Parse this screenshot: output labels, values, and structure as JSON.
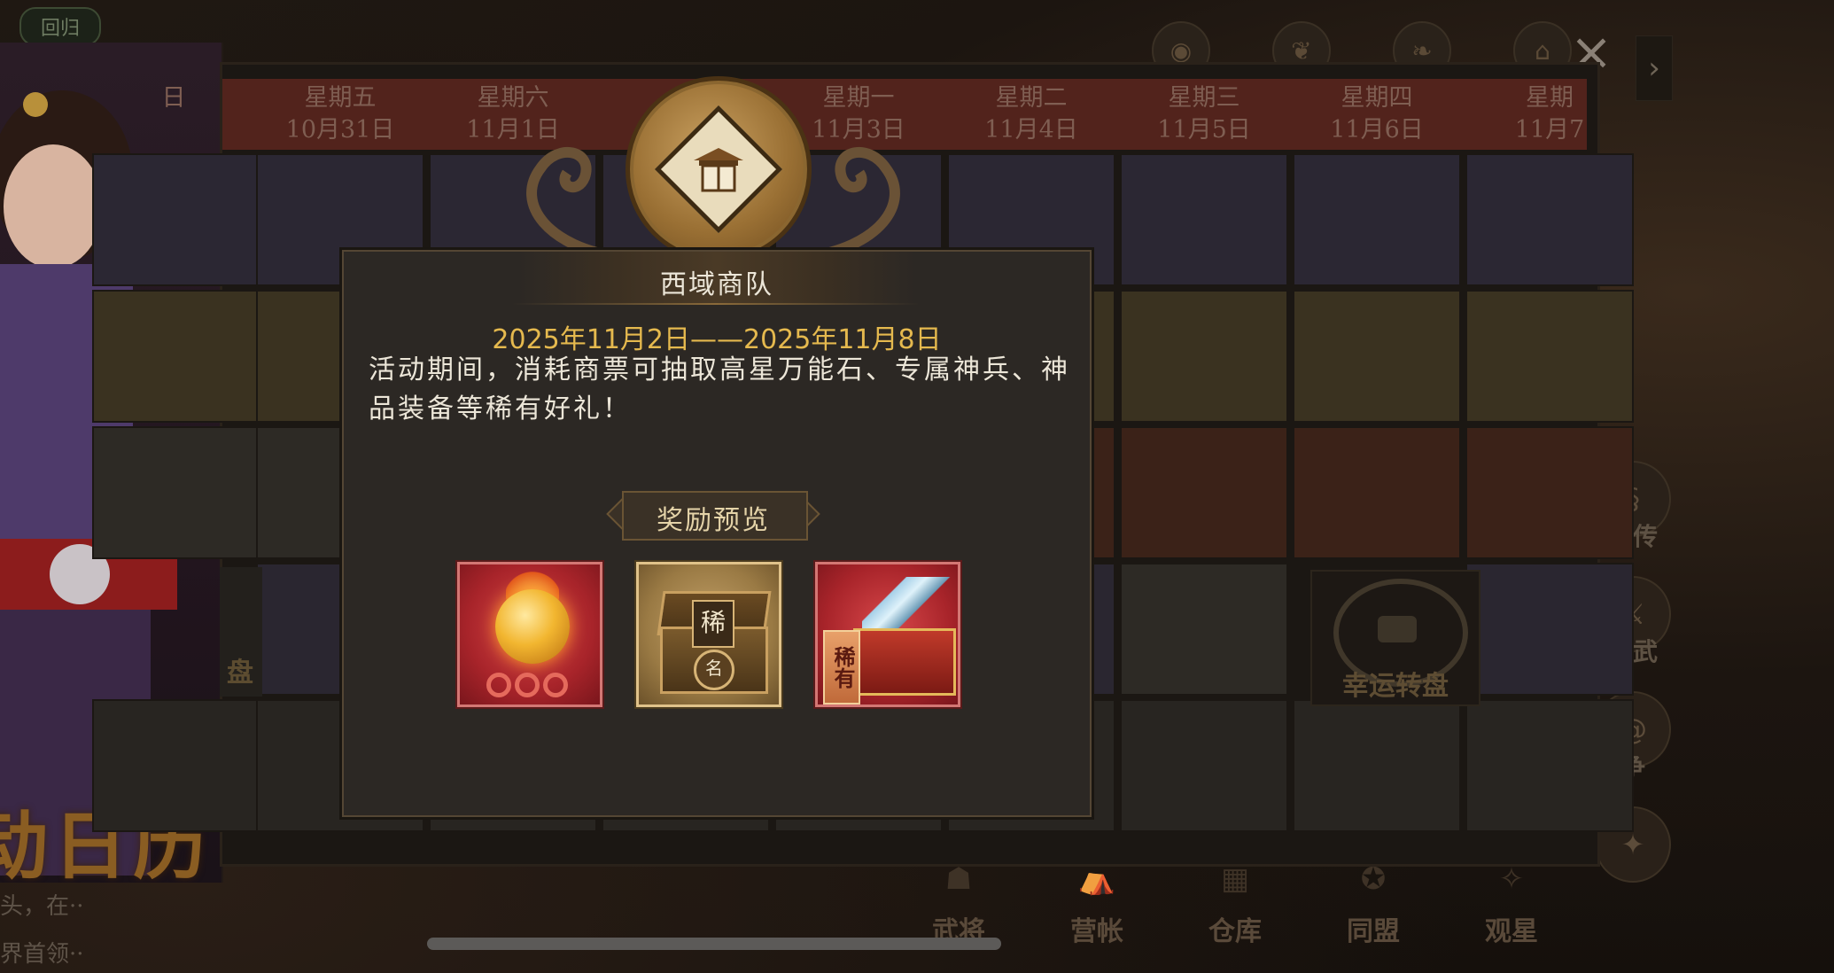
{
  "background": {
    "top_left_tag": "回归",
    "top_icons": [
      "medal-icon",
      "leaf-icon",
      "leaf2-icon",
      "gift-icon"
    ],
    "right_icons": [
      {
        "icon": "scroll-icon",
        "label": "列传"
      },
      {
        "icon": "sword-icon",
        "label": "演武"
      },
      {
        "icon": "swirl-icon",
        "label": "争"
      },
      {
        "icon": "compass-icon",
        "label": ""
      }
    ],
    "bottom_nav": [
      "武将",
      "营帐",
      "仓库",
      "同盟",
      "观星"
    ],
    "left_captions": [
      "头，在··",
      "界首领··"
    ]
  },
  "calendar": {
    "title": "动日历",
    "days": [
      {
        "weekday": "",
        "date": "日"
      },
      {
        "weekday": "星期五",
        "date": "10月31日"
      },
      {
        "weekday": "星期六",
        "date": "11月1日"
      },
      {
        "weekday": "",
        "date": ""
      },
      {
        "weekday": "星期一",
        "date": "11月3日"
      },
      {
        "weekday": "星期二",
        "date": "11月4日"
      },
      {
        "weekday": "星期三",
        "date": "11月5日"
      },
      {
        "weekday": "星期四",
        "date": "11月6日"
      },
      {
        "weekday": "星期",
        "date": "11月7"
      }
    ],
    "wheel_label": "幸运转盘",
    "left_sliver_label": "盘"
  },
  "popup": {
    "title": "西域商队",
    "date_range": "2025年11月2日——2025年11月8日",
    "description": "活动期间，消耗商票可抽取高星万能石、专属神兵、神品装备等稀有好礼！",
    "reward_label": "奖励预览",
    "items": [
      {
        "name": "high-star-universal-stone",
        "frame": "red"
      },
      {
        "name": "exclusive-weapon-chest",
        "frame": "gold",
        "tag": "稀",
        "seal": "名"
      },
      {
        "name": "rare-equipment-chest",
        "frame": "red",
        "banner": "稀有"
      }
    ]
  },
  "colors": {
    "accent_gold": "#e5b94e",
    "header_red": "#52231c",
    "popup_bg": "#2c2824"
  }
}
